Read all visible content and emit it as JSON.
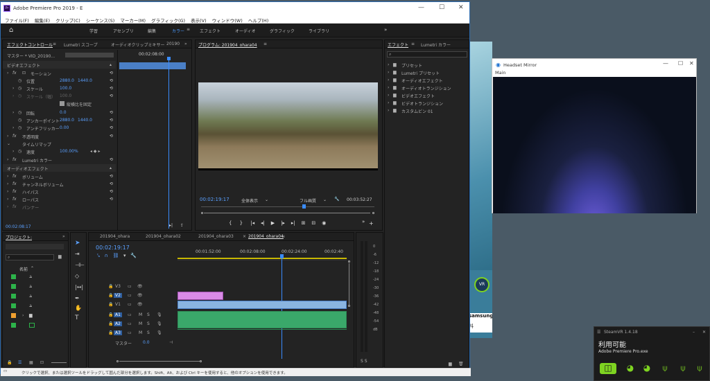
{
  "premiere": {
    "title": "Adobe Premiere Pro 2019 - E",
    "menu": [
      "ファイル(F)",
      "編集(E)",
      "クリップ(C)",
      "シーケンス(S)",
      "マーカー(M)",
      "グラフィック(G)",
      "表示(V)",
      "ウィンドウ(W)",
      "ヘルプ(H)"
    ],
    "workspaces": [
      "学習",
      "アセンブリ",
      "編集",
      "カラー",
      "エフェクト",
      "オーディオ",
      "グラフィック",
      "ライブラリ"
    ],
    "active_workspace": "カラー",
    "effect_controls": {
      "tabs": [
        "エフェクトコントロール",
        "Lumetri スコープ",
        "オーディオクリップミキサー",
        "20190"
      ],
      "master": "マスター * VID_20190...",
      "timecode": "00:02:08:00",
      "sections": {
        "video": "ビデオエフェクト",
        "motion": "モーション",
        "position": "位置",
        "position_x": "2880.0",
        "position_y": "1440.0",
        "scale": "スケール",
        "scale_val": "100.0",
        "scale_w": "スケール（幅）",
        "scale_w_val": "100.0",
        "uniform": "縦横比を固定",
        "rotation": "回転",
        "rotation_val": "0.0",
        "anchor": "アンカーポイント",
        "anchor_x": "2880.0",
        "anchor_y": "1440.0",
        "flicker": "アンチフリッカー",
        "flicker_val": "0.00",
        "opacity": "不透明度",
        "timeremap": "タイムリマップ",
        "speed": "速度",
        "speed_val": "100.00%",
        "lumetri": "Lumetri カラー",
        "audio": "オーディオエフェクト",
        "volume": "ボリューム",
        "channel_vol": "チャンネルボリューム",
        "highpass": "ハイパス",
        "lowpass": "ローパス",
        "panner": "パンナー"
      },
      "bottom_tc": "00:02:08:17"
    },
    "program": {
      "tab": "プログラム: 201904_ohara04",
      "timecode": "00:02:19:17",
      "fit": "全体表示",
      "quality": "フル画質",
      "duration": "00:03:52:27"
    },
    "effects": {
      "tabs": [
        "エフェクト",
        "Lumetri カラー"
      ],
      "items": [
        "プリセット",
        "Lumetri プリセット",
        "オーディオエフェクト",
        "オーディオトランジション",
        "ビデオエフェクト",
        "ビデオトランジション",
        "カスタムビン 01"
      ]
    },
    "project": {
      "tab": "プロジェクト:",
      "sort_label": "名前"
    },
    "timeline": {
      "tabs": [
        "201904_ohara",
        "201904_ohara02",
        "201904_ohara03",
        "201904_ohara04"
      ],
      "timecode": "00:02:19:17",
      "ruler": [
        "00:01:52:00",
        "00:02:08:00",
        "00:02:24:00",
        "00:02:40"
      ],
      "tracks": [
        "V3",
        "V2",
        "V1",
        "A1",
        "A2",
        "A3"
      ],
      "master": "マスター",
      "master_val": "0.0"
    },
    "meter": [
      "0",
      "-6",
      "-12",
      "-18",
      "-24",
      "-30",
      "-36",
      "-42",
      "-48",
      "-54",
      "dB"
    ],
    "meter_labels": "S  S",
    "status": "クリックで選択、または選択ツールをドラッグして囲んだ部分を選択します。Shift、Alt、および Ctrl キーを使用すると、他のオプションを使用できます。"
  },
  "headset": {
    "title": "Headset Mirror",
    "main": "Main"
  },
  "steamvr": {
    "title": "SteamVR 1.4.18",
    "status": "利用可能",
    "app": "Adobe Premiere Pro.exe"
  },
  "background": {
    "vr": "VR",
    "brand": "samsung",
    "free": "料"
  }
}
